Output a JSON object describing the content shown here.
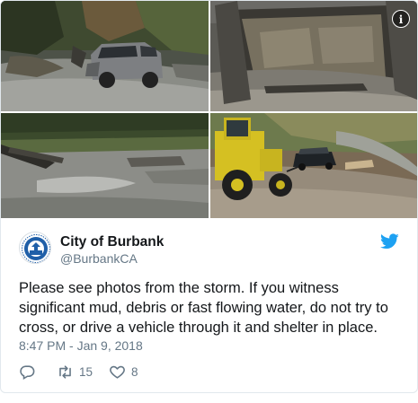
{
  "tweet": {
    "author_name": "City of Burbank",
    "author_handle": "@BurbankCA",
    "text": "Please see photos from the storm. If you witness significant mud, debris or fast flowing water, do not try to cross, or drive a vehicle through it and shelter in place.",
    "timestamp": "8:47 PM - Jan 9, 2018",
    "retweet_count": "15",
    "like_count": "8",
    "info_label": "i"
  },
  "colors": {
    "twitter_blue": "#1da1f2",
    "muted_text": "#657786",
    "primary_text": "#14171a",
    "border": "#e1e8ed"
  },
  "icons": {
    "info": "info-icon",
    "bird": "twitter-bird-icon",
    "reply": "reply-icon",
    "retweet": "retweet-icon",
    "like": "heart-icon"
  }
}
